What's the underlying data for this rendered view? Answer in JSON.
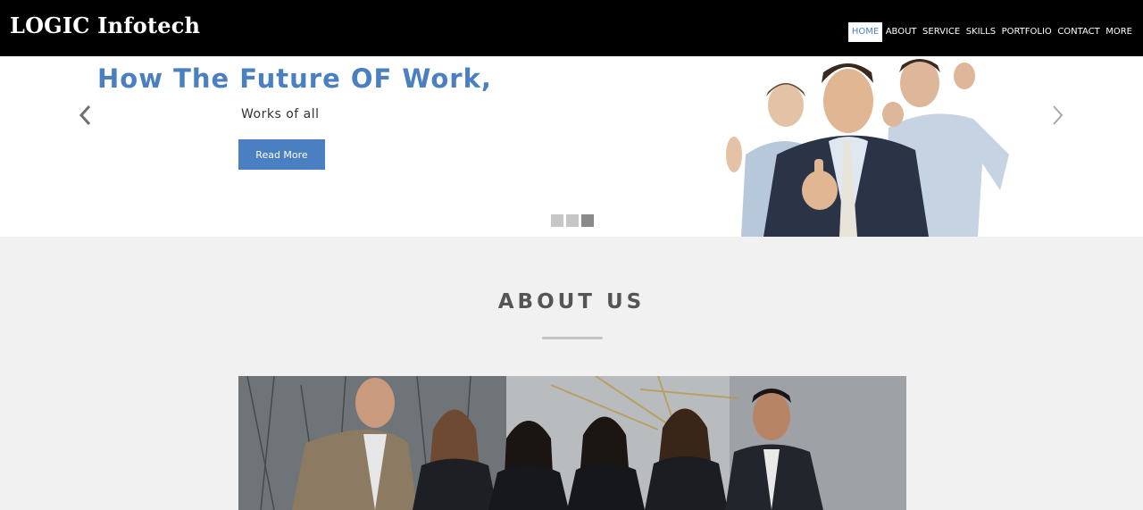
{
  "header": {
    "brand": "LOGIC Infotech",
    "nav": [
      {
        "label": "HOME",
        "active": true
      },
      {
        "label": "ABOUT"
      },
      {
        "label": "SERVICE"
      },
      {
        "label": "SKILLS"
      },
      {
        "label": "PORTFOLIO"
      },
      {
        "label": "CONTACT"
      },
      {
        "label": "MORE"
      }
    ]
  },
  "hero": {
    "title": "How The Future OF Work,",
    "subtitle": "Works of all",
    "button": "Read More",
    "slides": 3,
    "active_slide": 3,
    "prev_icon": "chevron-left-icon",
    "next_icon": "chevron-right-icon"
  },
  "about": {
    "title": "ABOUT US"
  },
  "colors": {
    "accent": "#4a7fc1",
    "navbar": "#000000",
    "section_bg": "#f1f1f1"
  }
}
